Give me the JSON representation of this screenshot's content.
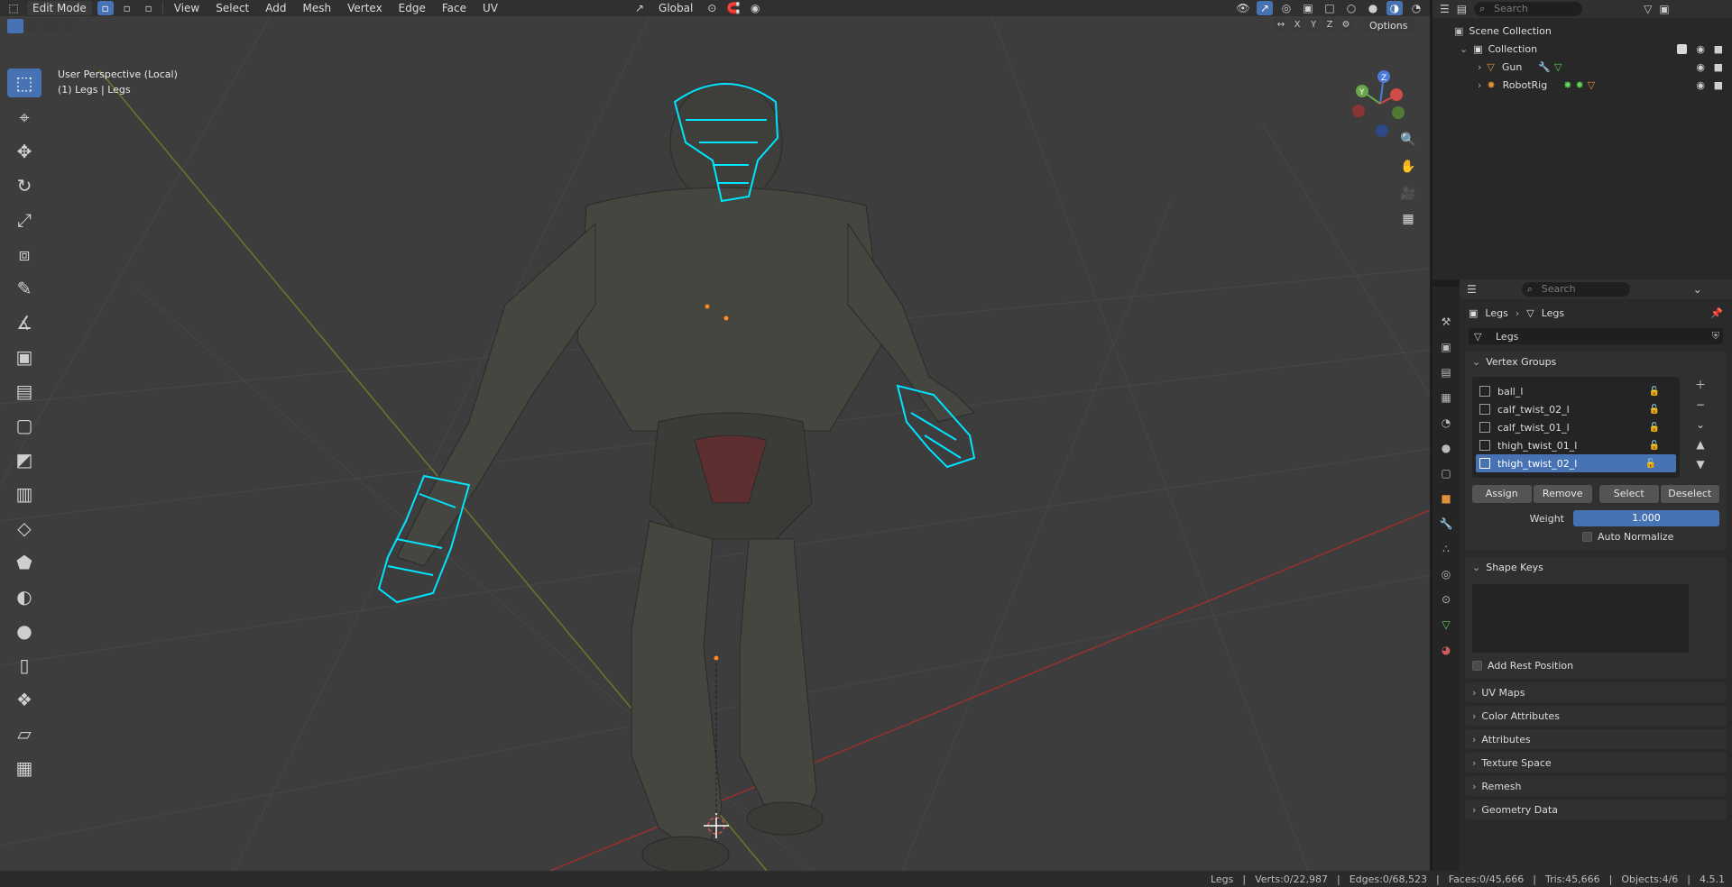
{
  "header": {
    "mode": "Edit Mode",
    "menus": [
      "View",
      "Select",
      "Add",
      "Mesh",
      "Vertex",
      "Edge",
      "Face",
      "UV"
    ],
    "orientation": "Global",
    "search_placeholder": "Search"
  },
  "toolbar2": {
    "axes": [
      "X",
      "Y",
      "Z"
    ],
    "options_label": "Options"
  },
  "viewport": {
    "view_name": "User Perspective (Local)",
    "object_line": "(1) Legs | Legs",
    "accent_color": "#00e5ff"
  },
  "outliner": {
    "scene_collection": "Scene Collection",
    "collection": "Collection",
    "objects": [
      "Gun",
      "RobotRig"
    ]
  },
  "properties": {
    "search_placeholder": "Search",
    "breadcrumb": [
      "Legs",
      "Legs"
    ],
    "mesh_name": "Legs",
    "vertex_groups": {
      "title": "Vertex Groups",
      "items": [
        "ball_l",
        "calf_twist_02_l",
        "calf_twist_01_l",
        "thigh_twist_01_l",
        "thigh_twist_02_l"
      ],
      "selected": "thigh_twist_02_l",
      "buttons": [
        "Assign",
        "Remove",
        "Select",
        "Deselect"
      ],
      "weight_label": "Weight",
      "weight_value": "1.000",
      "auto_normalize": "Auto Normalize"
    },
    "shape_keys": {
      "title": "Shape Keys",
      "add_rest": "Add Rest Position"
    },
    "collapsed_panels": [
      "UV Maps",
      "Color Attributes",
      "Attributes",
      "Texture Space",
      "Remesh",
      "Geometry Data"
    ]
  },
  "statusbar": {
    "object": "Legs",
    "verts": "Verts:0/22,987",
    "edges": "Edges:0/68,523",
    "faces": "Faces:0/45,666",
    "tris": "Tris:45,666",
    "objects": "Objects:4/6",
    "version": "4.5.1"
  }
}
